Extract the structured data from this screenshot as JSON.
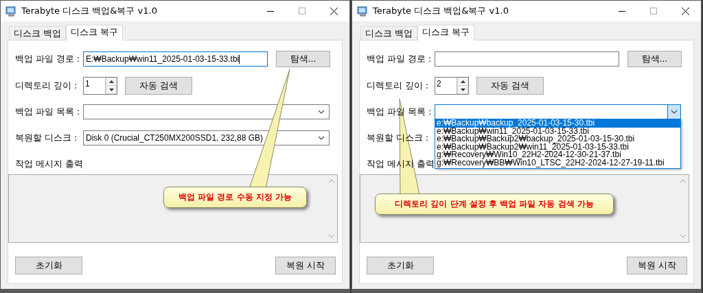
{
  "windows": [
    {
      "title": "Terabyte 디스크 백업&복구 v1.0",
      "tabs": [
        {
          "label": "디스크 백업",
          "selected": false
        },
        {
          "label": "디스크 복구",
          "selected": true
        }
      ],
      "path_field": {
        "label": "백업 파일 경로 :",
        "value": "E:₩Backup₩win11_2025-01-03-15-33.tbi",
        "focused": true
      },
      "browse_button": "탐색...",
      "depth": {
        "label": "디렉토리 깊이 :",
        "value": "1"
      },
      "auto_search_button": "자동 검색",
      "file_list": {
        "label": "백업 파일 목록 :",
        "expanded": false
      },
      "target_disk": {
        "label": "복원할 디스크 :",
        "value": "Disk 0 (Crucial_CT250MX200SSD1, 232,88 GB)"
      },
      "log": {
        "label": "작업 메시지 출력"
      },
      "reset_button": "초기화",
      "restore_button": "복원 시작",
      "callout": {
        "text": "백업 파일 경로 수동 지정 가능"
      }
    },
    {
      "title": "Terabyte 디스크 백업&복구 v1.0",
      "tabs": [
        {
          "label": "디스크 백업",
          "selected": false
        },
        {
          "label": "디스크 복구",
          "selected": true
        }
      ],
      "path_field": {
        "label": "백업 파일 경로 :",
        "focused": false
      },
      "browse_button": "탐색...",
      "depth": {
        "label": "디렉토리 깊이 :",
        "value": "2"
      },
      "auto_search_button": "자동 검색",
      "file_list": {
        "label": "백업 파일 목록 :",
        "expanded": true,
        "options": [
          {
            "text": "e:₩Backup₩backup_2025-01-03-15-30.tbi",
            "selected": true
          },
          {
            "text": "e:₩Backup₩win11_2025-01-03-15-33.tbi",
            "selected": false
          },
          {
            "text": "e:₩Backup₩Backup2₩backup_2025-01-03-15-30.tbi",
            "selected": false
          },
          {
            "text": "e:₩Backup₩Backup2₩win11_2025-01-03-15-33.tbi",
            "selected": false
          },
          {
            "text": "g:₩Recovery₩Win10_22H2-2024-12-30-21-37.tbi",
            "selected": false
          },
          {
            "text": "g:₩Recovery₩BB₩Win10_LTSC_22H2-2024-12-27-19-11.tbi",
            "selected": false
          }
        ]
      },
      "target_disk": {
        "label": "복원할 디스크 :"
      },
      "log": {
        "label": "작업 메시지 출력"
      },
      "reset_button": "초기화",
      "restore_button": "복원 시작",
      "callout": {
        "text": "디렉토리 깊이 단계 설정 후 백업 파일 자동 검색 가능"
      }
    }
  ]
}
